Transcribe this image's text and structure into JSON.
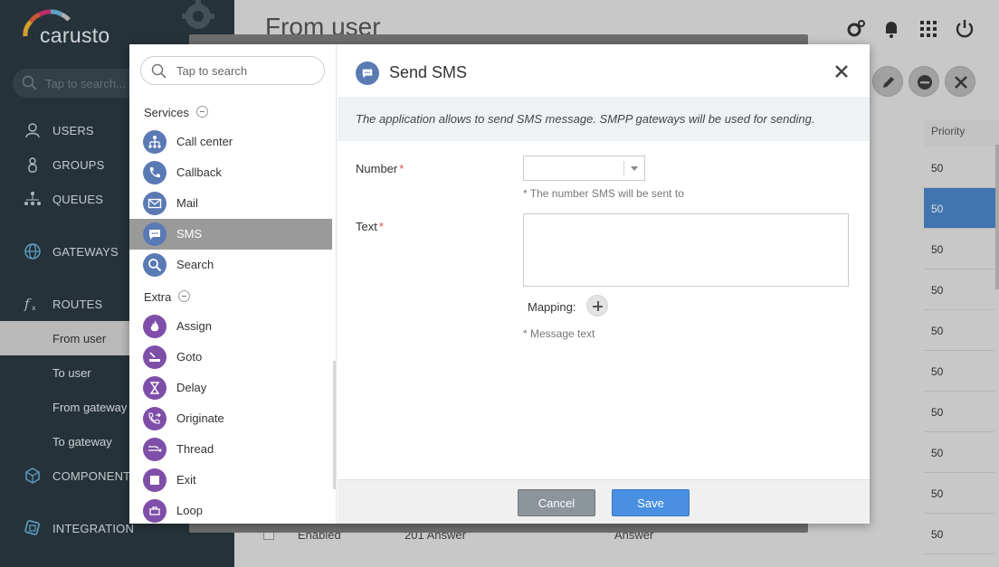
{
  "app": {
    "brand": "carusto",
    "search_placeholder": "Tap to search..."
  },
  "sidebar": {
    "items": [
      {
        "label": "USERS",
        "icon": "user-icon"
      },
      {
        "label": "GROUPS",
        "icon": "groups-icon"
      },
      {
        "label": "QUEUES",
        "icon": "queues-icon"
      },
      {
        "label": "GATEWAYS",
        "icon": "globe-icon"
      },
      {
        "label": "ROUTES",
        "icon": "function-icon"
      },
      {
        "label": "COMPONENTS",
        "icon": "cube-icon"
      },
      {
        "label": "INTEGRATION",
        "icon": "integration-icon"
      }
    ],
    "routes_sub": [
      {
        "label": "From user",
        "active": true
      },
      {
        "label": "To user"
      },
      {
        "label": "From gateway"
      },
      {
        "label": "To gateway"
      }
    ]
  },
  "main": {
    "title": "From user",
    "priority_header": "Priority",
    "priority_values": [
      "50",
      "50",
      "50",
      "50",
      "50",
      "50",
      "50",
      "50",
      "50",
      "50"
    ],
    "bottom_row": {
      "status": "Enabled",
      "name": "201 Answer",
      "action": "Answer"
    }
  },
  "dialog": {
    "palette": {
      "search_placeholder": "Tap to search",
      "group_services": "Services",
      "group_extra": "Extra",
      "services": [
        {
          "label": "Call center",
          "icon": "org-chart-icon"
        },
        {
          "label": "Callback",
          "icon": "phone-icon"
        },
        {
          "label": "Mail",
          "icon": "envelope-icon"
        },
        {
          "label": "SMS",
          "icon": "chat-icon",
          "active": true
        },
        {
          "label": "Search",
          "icon": "search-icon"
        }
      ],
      "extra": [
        {
          "label": "Assign",
          "icon": "flame-icon"
        },
        {
          "label": "Goto",
          "icon": "goto-icon"
        },
        {
          "label": "Delay",
          "icon": "hourglass-icon"
        },
        {
          "label": "Originate",
          "icon": "phone-forward-icon"
        },
        {
          "label": "Thread",
          "icon": "thread-icon"
        },
        {
          "label": "Exit",
          "icon": "stop-icon"
        },
        {
          "label": "Loop",
          "icon": "loop-icon"
        }
      ]
    },
    "form": {
      "title": "Send SMS",
      "description": "The application allows to send SMS message. SMPP gateways will be used for sending.",
      "number_label": "Number",
      "required_mark": "*",
      "number_value": "",
      "number_hint": "* The number SMS will be sent to",
      "text_label": "Text",
      "text_value": "",
      "mapping_label": "Mapping:",
      "text_hint": "* Message text",
      "cancel_label": "Cancel",
      "save_label": "Save"
    }
  }
}
